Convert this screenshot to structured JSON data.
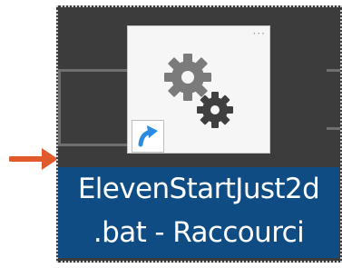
{
  "shortcut": {
    "label_line1": "ElevenStartJust2d",
    "label_line2": ".bat - Raccourci",
    "icon": "gears-icon",
    "overlay_icon": "shortcut-arrow-icon",
    "window_indicator": "···"
  },
  "annotation": {
    "icon": "orange-arrow-icon",
    "color": "#e05a2b"
  },
  "colors": {
    "selection": "#0e4c83",
    "background": "#3c3c3c",
    "gear": "#7b7b7b",
    "gear_dark": "#3f3f3f",
    "badge_arrow": "#2b8be0"
  }
}
